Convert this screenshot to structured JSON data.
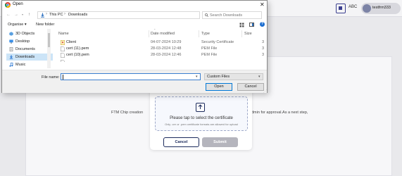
{
  "background_app": {
    "header": {
      "abc_label": "ABC",
      "username": "testfrm333"
    },
    "heading_fragment": "y!",
    "description_left": "FTM Chip creation",
    "description_right": "dmin for approval.As a next step,"
  },
  "upload_modal": {
    "drop_title": "Please tap to select the certificate",
    "drop_hint": "Only .cer or .pem certificate formats are allowed for upload",
    "cancel_label": "Cancel",
    "submit_label": "Submit"
  },
  "open_dialog": {
    "title": "Open",
    "close_glyph": "✕",
    "address": {
      "segments": [
        "This PC",
        "Downloads"
      ],
      "separator": "›"
    },
    "search_placeholder": "Search Downloads",
    "toolbar": {
      "organise_label": "Organise ▾",
      "new_folder_label": "New folder"
    },
    "sidebar": [
      {
        "label": "3D Objects",
        "icon": "3d-objects-icon"
      },
      {
        "label": "Desktop",
        "icon": "desktop-icon"
      },
      {
        "label": "Documents",
        "icon": "documents-icon"
      },
      {
        "label": "Downloads",
        "icon": "downloads-icon",
        "selected": true
      },
      {
        "label": "Music",
        "icon": "music-icon"
      }
    ],
    "columns": {
      "name": "Name",
      "date_modified": "Date modified",
      "type": "Type",
      "size": "Size"
    },
    "files": [
      {
        "name": "Client",
        "date": "04-07-2024 10:29",
        "type": "Security Certificate",
        "size": "3"
      },
      {
        "name": "cert (11).pem",
        "date": "28-03-2024 12:48",
        "type": "PEM File",
        "size": "3"
      },
      {
        "name": "cert (10).pem",
        "date": "28-03-2024 12:46",
        "type": "PEM File",
        "size": "3"
      }
    ],
    "file_name_label": "File name:",
    "file_name_value": "",
    "file_type_value": "Custom Files",
    "open_label": "Open",
    "cancel_label": "Cancel"
  },
  "colors": {
    "accent_blue": "#0078d7",
    "brand_navy": "#1b2a5c",
    "selected_bg": "#cce4f7"
  }
}
